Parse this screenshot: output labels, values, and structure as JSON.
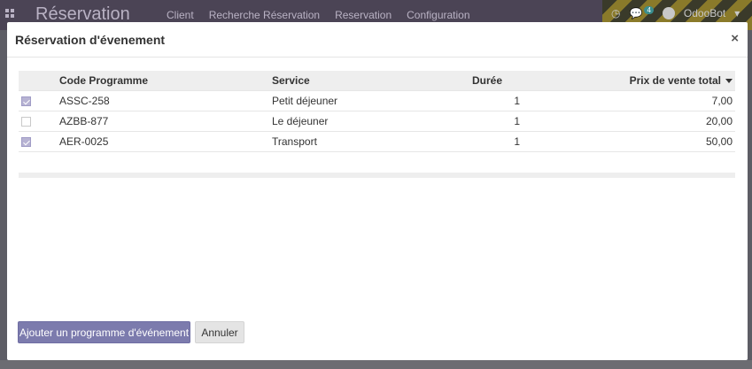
{
  "background": {
    "app_title": "Réservation",
    "menu": [
      "Client",
      "Recherche Réservation",
      "Reservation",
      "Configuration"
    ],
    "chat_count": "4",
    "user": "OdooBot"
  },
  "modal": {
    "title": "Réservation d'évenement",
    "close_label": "×"
  },
  "table": {
    "headers": {
      "code": "Code Programme",
      "service": "Service",
      "duree": "Durée",
      "prix": "Prix de vente total"
    },
    "rows": [
      {
        "checked": true,
        "code": "ASSC-258",
        "service": "Petit déjeuner",
        "duree": "1",
        "prix": "7,00"
      },
      {
        "checked": false,
        "code": "AZBB-877",
        "service": "Le déjeuner",
        "duree": "1",
        "prix": "20,00"
      },
      {
        "checked": true,
        "code": "AER-0025",
        "service": "Transport",
        "duree": "1",
        "prix": "50,00"
      }
    ]
  },
  "buttons": {
    "add_label": "Ajouter un programme d'événement",
    "cancel_label": "Annuler"
  },
  "colors": {
    "primary": "#7c7bad",
    "checkbox_checked": "#b7b3d3"
  }
}
